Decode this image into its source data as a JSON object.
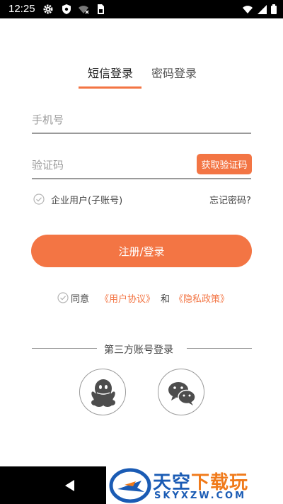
{
  "status_bar": {
    "time": "12:25",
    "icons_left": [
      "gear-icon",
      "shield-icon",
      "wifi-off-icon",
      "sim-card-icon"
    ],
    "icons_right": [
      "wifi-icon",
      "signal-icon",
      "battery-icon"
    ]
  },
  "tabs": [
    {
      "label": "短信登录",
      "active": true
    },
    {
      "label": "密码登录",
      "active": false
    }
  ],
  "form": {
    "phone_placeholder": "手机号",
    "code_placeholder": "验证码",
    "get_code_label": "获取验证码",
    "enterprise_label": "企业用户(子账号)",
    "forgot_label": "忘记密码?",
    "submit_label": "注册/登录"
  },
  "agreement": {
    "agree": "同意",
    "user_agreement": "《用户协议》",
    "and": "和",
    "privacy_policy": "《隐私政策》"
  },
  "third_party": {
    "title": "第三方账号登录",
    "providers": [
      "qq-icon",
      "wechat-icon"
    ]
  },
  "watermark": {
    "title_blue": "天空",
    "title_orange": "下载玩",
    "sub": "SKYXZW.COM"
  },
  "colors": {
    "accent": "#f37544",
    "watermark_blue": "#1a5bb4",
    "watermark_orange": "#f07a1a"
  }
}
